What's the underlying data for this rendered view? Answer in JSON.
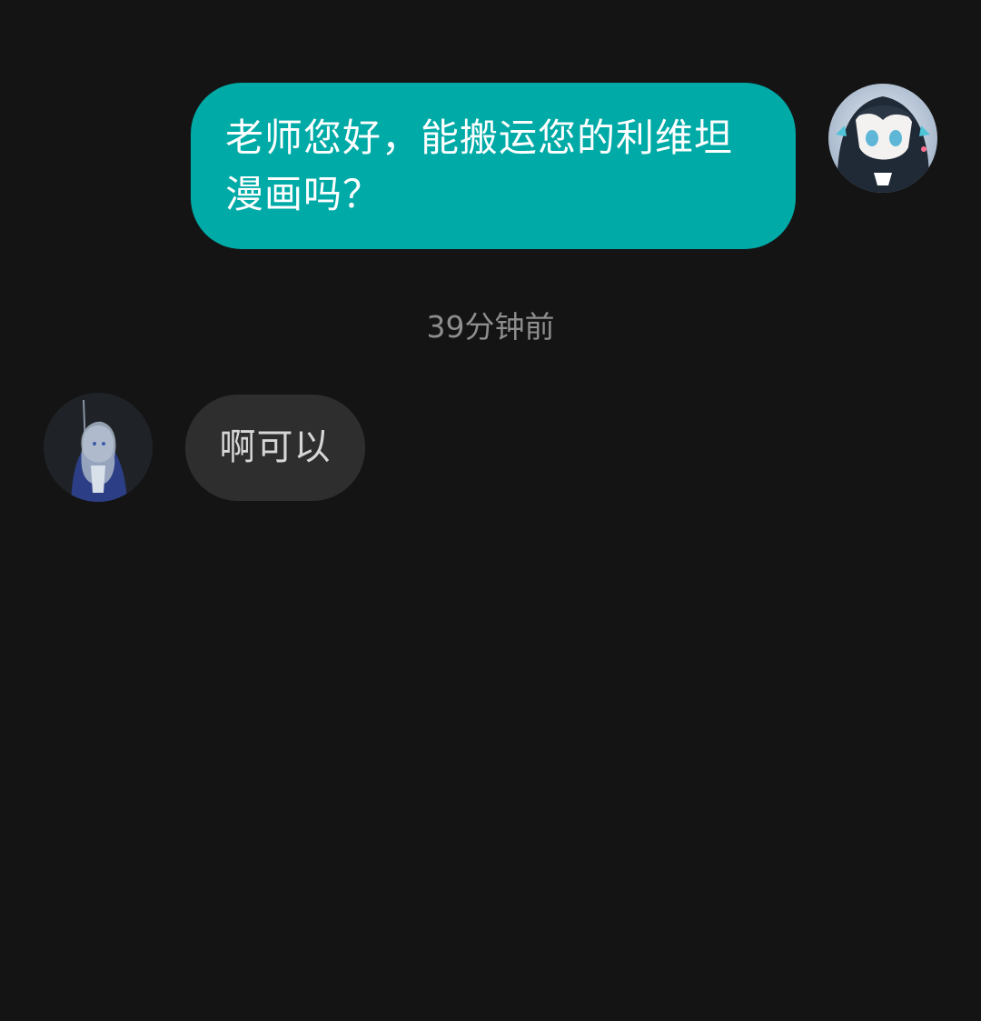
{
  "messages": {
    "outgoing": {
      "line1": "老师您好，能搬运您的利维坦",
      "line2": "漫画吗？"
    },
    "timestamp": "39分钟前",
    "incoming": {
      "text": "啊可以"
    }
  },
  "colors": {
    "background": "#141414",
    "outgoing_bubble": "#00aaa6",
    "incoming_bubble": "#2e2e2e",
    "timestamp_text": "#8e8e8e"
  },
  "icons": {
    "my_avatar": "user-avatar-icon",
    "contact_avatar": "contact-avatar-icon"
  }
}
